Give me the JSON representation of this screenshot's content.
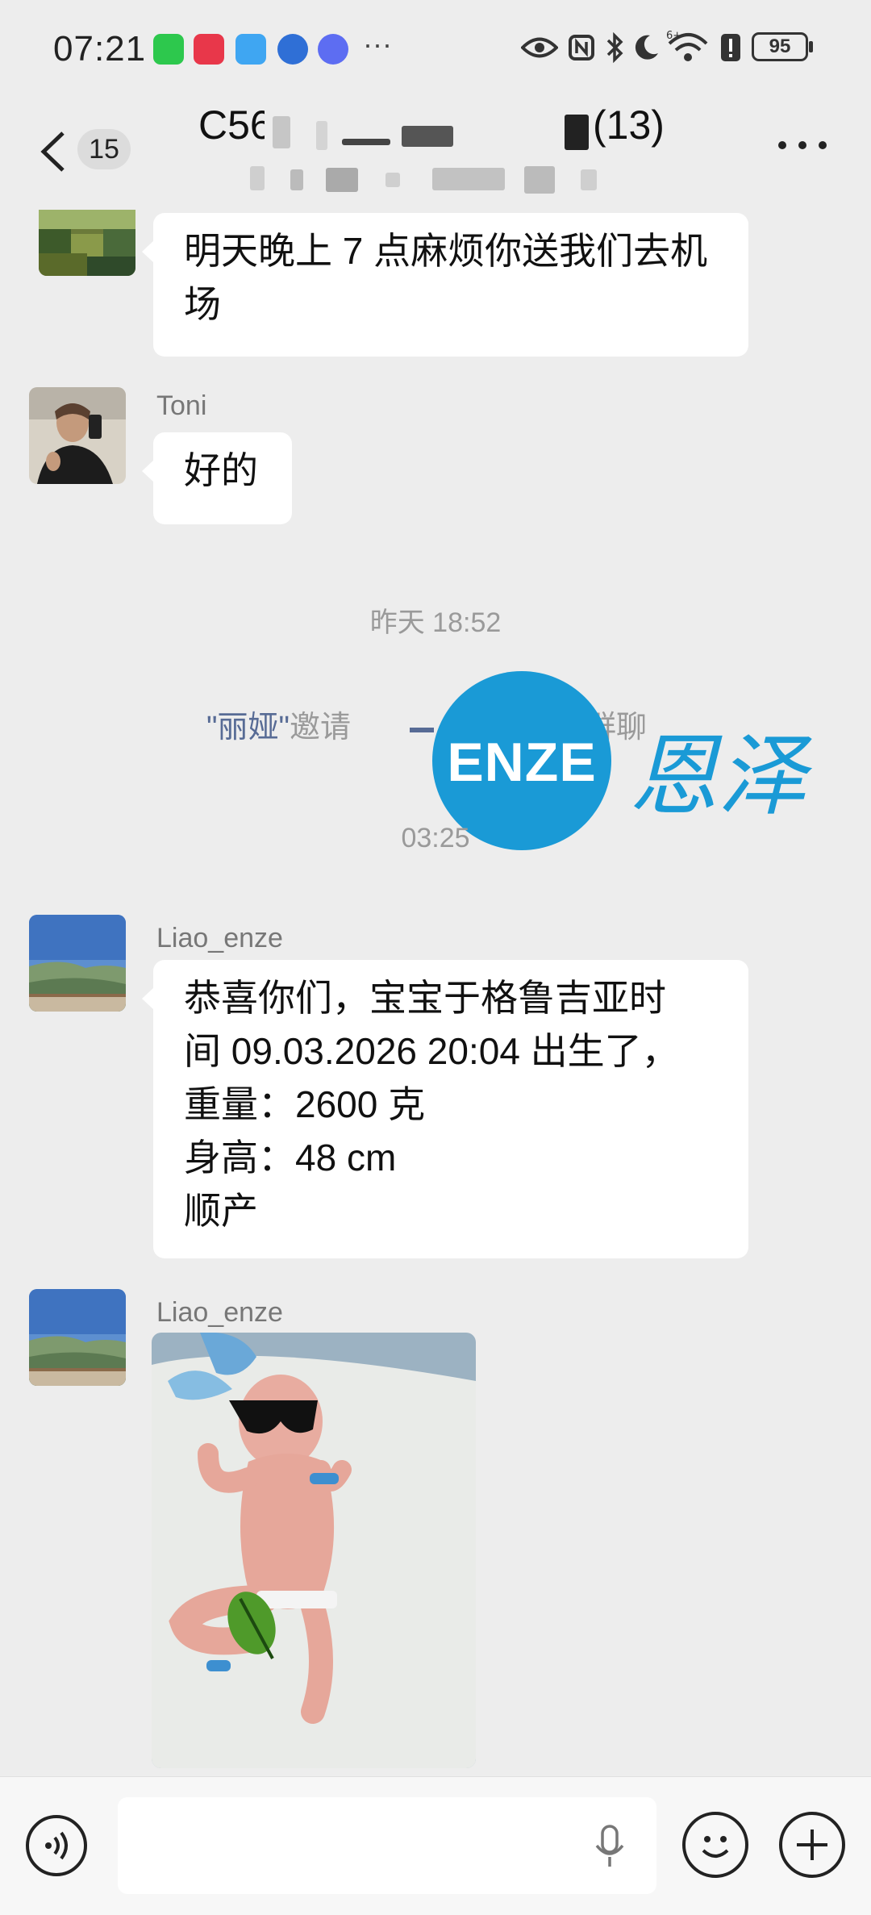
{
  "status_bar": {
    "time": "07:21",
    "battery": "95",
    "app_icons": [
      "wechat-icon",
      "app-icon-red",
      "weather-icon",
      "browser-icon",
      "music-icon"
    ],
    "more": "···"
  },
  "header": {
    "unread_count": "15",
    "title_prefix": "C56",
    "title_suffix": "(13)",
    "more_icon": "more-icon"
  },
  "messages": [
    {
      "text": "明天晚上 7 点麻烦你送我们去机场"
    },
    {
      "sender": "Toni",
      "text": "好的"
    },
    {
      "sender": "Liao_enze",
      "text_lines": [
        "恭喜你们，宝宝于格鲁吉亚时",
        "间 09.03.2026 20:04 出生了，",
        "重量：2600 克",
        "身高：48 cm",
        "顺产"
      ]
    },
    {
      "sender": "Liao_enze",
      "type": "image"
    }
  ],
  "system": {
    "time1": "昨天 18:52",
    "invite_name": "\"丽娅\"",
    "invite_word": "邀请",
    "invite_end": "群聊",
    "time2": "03:25"
  },
  "watermark": {
    "logo_text": "ENZE",
    "chinese": "恩泽",
    "color": "#1a9ad6"
  },
  "input": {
    "placeholder": ""
  },
  "colors": {
    "background": "#ededed",
    "bubble": "#ffffff",
    "accent_blue": "#1a9ad6"
  }
}
